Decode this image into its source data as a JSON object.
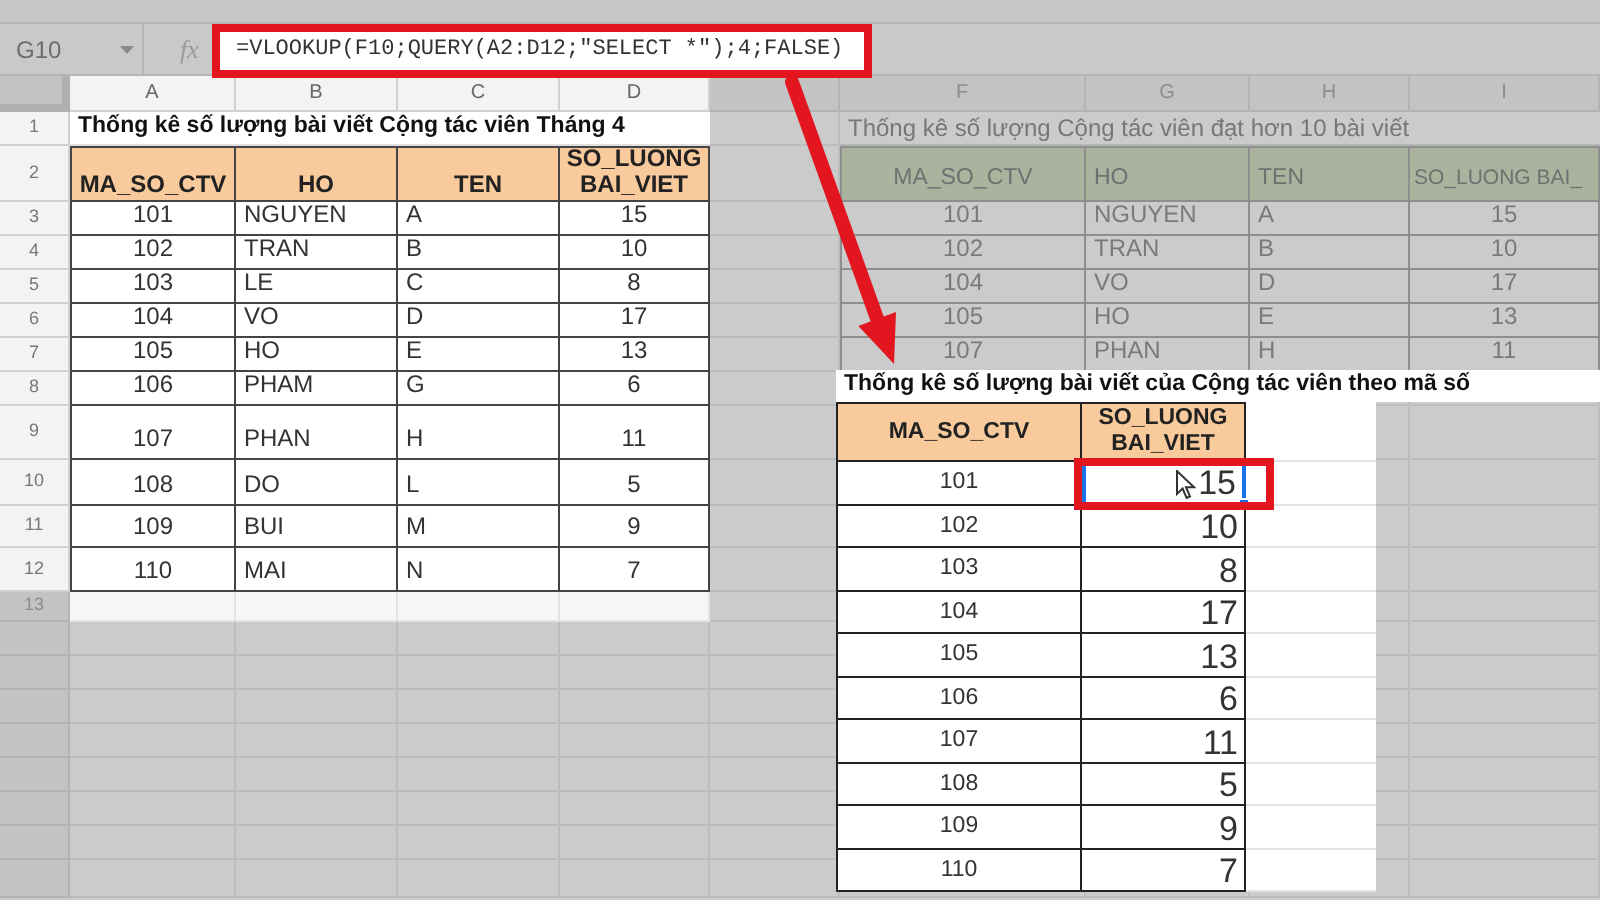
{
  "formula_bar": {
    "name_box": "G10",
    "fx_label": "fx",
    "formula": "=VLOOKUP(F10;QUERY(A2:D12;\"SELECT *\");4;FALSE)"
  },
  "column_headers": [
    "A",
    "B",
    "C",
    "D",
    "F",
    "G",
    "H",
    "I"
  ],
  "row_headers": [
    "1",
    "2",
    "3",
    "4",
    "5",
    "6",
    "7",
    "8",
    "9",
    "10",
    "11",
    "12",
    "13"
  ],
  "table_1": {
    "title": "Thống kê số lượng bài viết Cộng tác viên Tháng 4",
    "columns": [
      "MA_SO_CTV",
      "HO",
      "TEN",
      "SO_LUONG BAI_VIET"
    ],
    "rows": [
      [
        "101",
        "NGUYEN",
        "A",
        "15"
      ],
      [
        "102",
        "TRAN",
        "B",
        "10"
      ],
      [
        "103",
        "LE",
        "C",
        "8"
      ],
      [
        "104",
        "VO",
        "D",
        "17"
      ],
      [
        "105",
        "HO",
        "E",
        "13"
      ],
      [
        "106",
        "PHAM",
        "G",
        "6"
      ],
      [
        "107",
        "PHAN",
        "H",
        "11"
      ],
      [
        "108",
        "DO",
        "L",
        "5"
      ],
      [
        "109",
        "BUI",
        "M",
        "9"
      ],
      [
        "110",
        "MAI",
        "N",
        "7"
      ]
    ]
  },
  "table_2": {
    "title": "Thống kê số lượng Cộng tác viên đạt hơn 10 bài viết",
    "columns": [
      "MA_SO_CTV",
      "HO",
      "TEN",
      "SO_LUONG BAI_"
    ],
    "rows": [
      [
        "101",
        "NGUYEN",
        "A",
        "15"
      ],
      [
        "102",
        "TRAN",
        "B",
        "10"
      ],
      [
        "104",
        "VO",
        "D",
        "17"
      ],
      [
        "105",
        "HO",
        "E",
        "13"
      ],
      [
        "107",
        "PHAN",
        "H",
        "11"
      ]
    ]
  },
  "table_3": {
    "title": "Thống kê số lượng bài viết của Cộng tác viên theo mã số",
    "columns": [
      "MA_SO_CTV",
      "SO_LUONG BAI_VIET"
    ],
    "rows": [
      {
        "cells": [
          "101",
          "15"
        ],
        "selected": true
      },
      {
        "cells": [
          "102",
          "10"
        ],
        "selected": false
      },
      {
        "cells": [
          "103",
          "8"
        ],
        "selected": false
      },
      {
        "cells": [
          "104",
          "17"
        ],
        "selected": false
      },
      {
        "cells": [
          "105",
          "13"
        ],
        "selected": false
      },
      {
        "cells": [
          "106",
          "6"
        ],
        "selected": false
      },
      {
        "cells": [
          "107",
          "11"
        ],
        "selected": false
      },
      {
        "cells": [
          "108",
          "5"
        ],
        "selected": false
      },
      {
        "cells": [
          "109",
          "9"
        ],
        "selected": false
      },
      {
        "cells": [
          "110",
          "7"
        ],
        "selected": false
      }
    ]
  }
}
